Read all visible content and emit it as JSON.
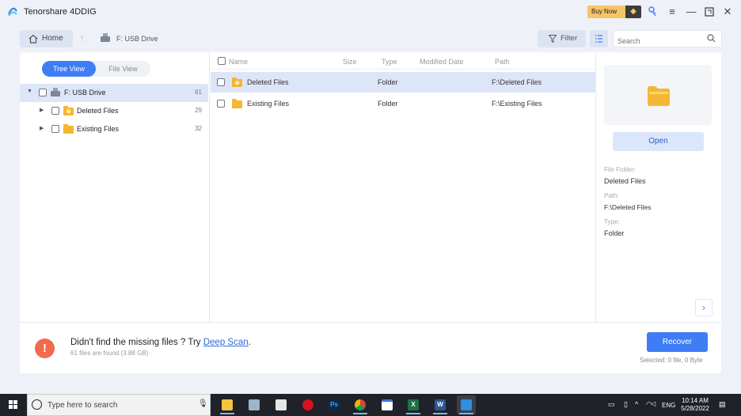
{
  "app": {
    "title": "Tenorshare 4DDIG",
    "buy_now": "Buy Now"
  },
  "nav": {
    "home": "Home",
    "breadcrumb": "F: USB Drive",
    "filter": "Filter",
    "search_placeholder": "Search"
  },
  "view_tabs": {
    "tree": "Tree View",
    "file": "File View"
  },
  "tree": [
    {
      "label": "F: USB Drive",
      "count": "61"
    },
    {
      "label": "Deleted Files",
      "count": "29"
    },
    {
      "label": "Existing Files",
      "count": "32"
    }
  ],
  "columns": {
    "name": "Name",
    "size": "Size",
    "type": "Type",
    "modified": "Modified Date",
    "path": "Path"
  },
  "rows": [
    {
      "name": "Deleted Files",
      "type": "Folder",
      "path": "F:\\Deleted Files"
    },
    {
      "name": "Existing Files",
      "type": "Folder",
      "path": "F:\\Existing Files"
    }
  ],
  "details": {
    "open": "Open",
    "folder_label": "File Folder:",
    "folder_value": "Deleted Files",
    "path_label": "Path:",
    "path_value": "F:\\Deleted Files",
    "type_label": "Type:",
    "type_value": "Folder"
  },
  "bottom": {
    "hint_prefix": "Didn't find the missing files ? Try ",
    "deep_scan": "Deep Scan",
    "hint_suffix": ".",
    "found": "61 files are found (3.88 GB)",
    "recover": "Recover",
    "selected": "Selected: 0 file, 0 Byte"
  },
  "taskbar": {
    "search_placeholder": "Type here to search",
    "lang": "ENG",
    "time": "10:14 AM",
    "date": "5/28/2022"
  },
  "colors": {
    "accent": "#3f7df5",
    "folder": "#f5b731",
    "warning": "#f26b4d"
  }
}
